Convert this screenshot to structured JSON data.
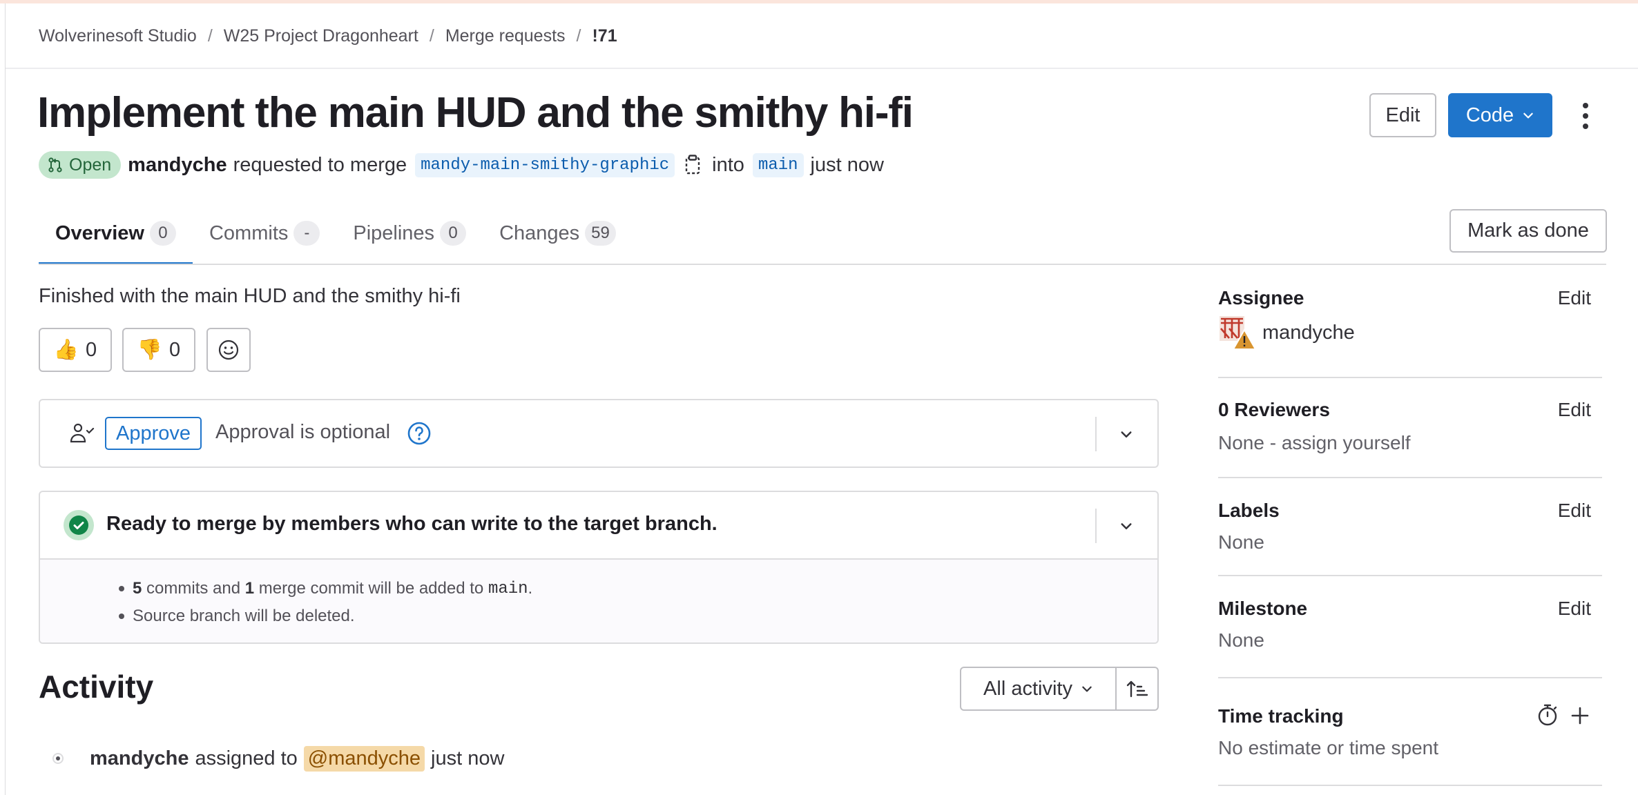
{
  "breadcrumb": {
    "items": [
      "Wolverinesoft Studio",
      "W25 Project Dragonheart",
      "Merge requests"
    ],
    "current": "!71",
    "separator": "/"
  },
  "merge_request": {
    "title": "Implement the main HUD and the smithy hi-fi",
    "status": "Open",
    "author": "mandyche",
    "action_text": "requested to merge",
    "source_branch": "mandy-main-smithy-graphic",
    "into_text": "into",
    "target_branch": "main",
    "time": "just now",
    "description": "Finished with the main HUD and the smithy hi-fi"
  },
  "header_buttons": {
    "edit_label": "Edit",
    "code_label": "Code"
  },
  "tabs": [
    {
      "label": "Overview",
      "count": "0"
    },
    {
      "label": "Commits",
      "count": "-"
    },
    {
      "label": "Pipelines",
      "count": "0"
    },
    {
      "label": "Changes",
      "count": "59"
    }
  ],
  "mark_done_label": "Mark as done",
  "reactions": {
    "thumbs_up_emoji": "👍",
    "thumbs_up_count": "0",
    "thumbs_down_emoji": "👎",
    "thumbs_down_count": "0"
  },
  "approval": {
    "button_label": "Approve",
    "status_text": "Approval is optional"
  },
  "merge_widget": {
    "title": "Ready to merge by members who can write to the target branch.",
    "commits_count": "5",
    "commits_text": "commits and",
    "merge_commit_count": "1",
    "merge_commit_text": "merge commit will be added to",
    "target": "main",
    "period": ".",
    "delete_note": "Source branch will be deleted."
  },
  "activity": {
    "title": "Activity",
    "filter_label": "All activity",
    "item": {
      "author": "mandyche",
      "action": "assigned to",
      "mention": "@mandyche",
      "time": "just now"
    }
  },
  "sidebar": {
    "edit_label": "Edit",
    "assignee": {
      "title": "Assignee",
      "name": "mandyche"
    },
    "reviewers": {
      "title": "0 Reviewers",
      "value": "None - assign yourself"
    },
    "labels": {
      "title": "Labels",
      "value": "None"
    },
    "milestone": {
      "title": "Milestone",
      "value": "None"
    },
    "time_tracking": {
      "title": "Time tracking",
      "value": "No estimate or time spent"
    }
  },
  "colors": {
    "primary": "#1f75cb",
    "open_badge_bg": "#c3e6cd",
    "open_badge_text": "#24663b",
    "success": "#108548",
    "mention_bg": "#f5d9a8"
  },
  "icons": [
    "merge-request-icon",
    "copy-branch-icon",
    "chevron-down-icon",
    "kebab-menu-icon",
    "smile-icon",
    "approval-icon",
    "help-icon",
    "check-circle-icon",
    "sort-icon",
    "timer-icon",
    "plus-icon"
  ]
}
